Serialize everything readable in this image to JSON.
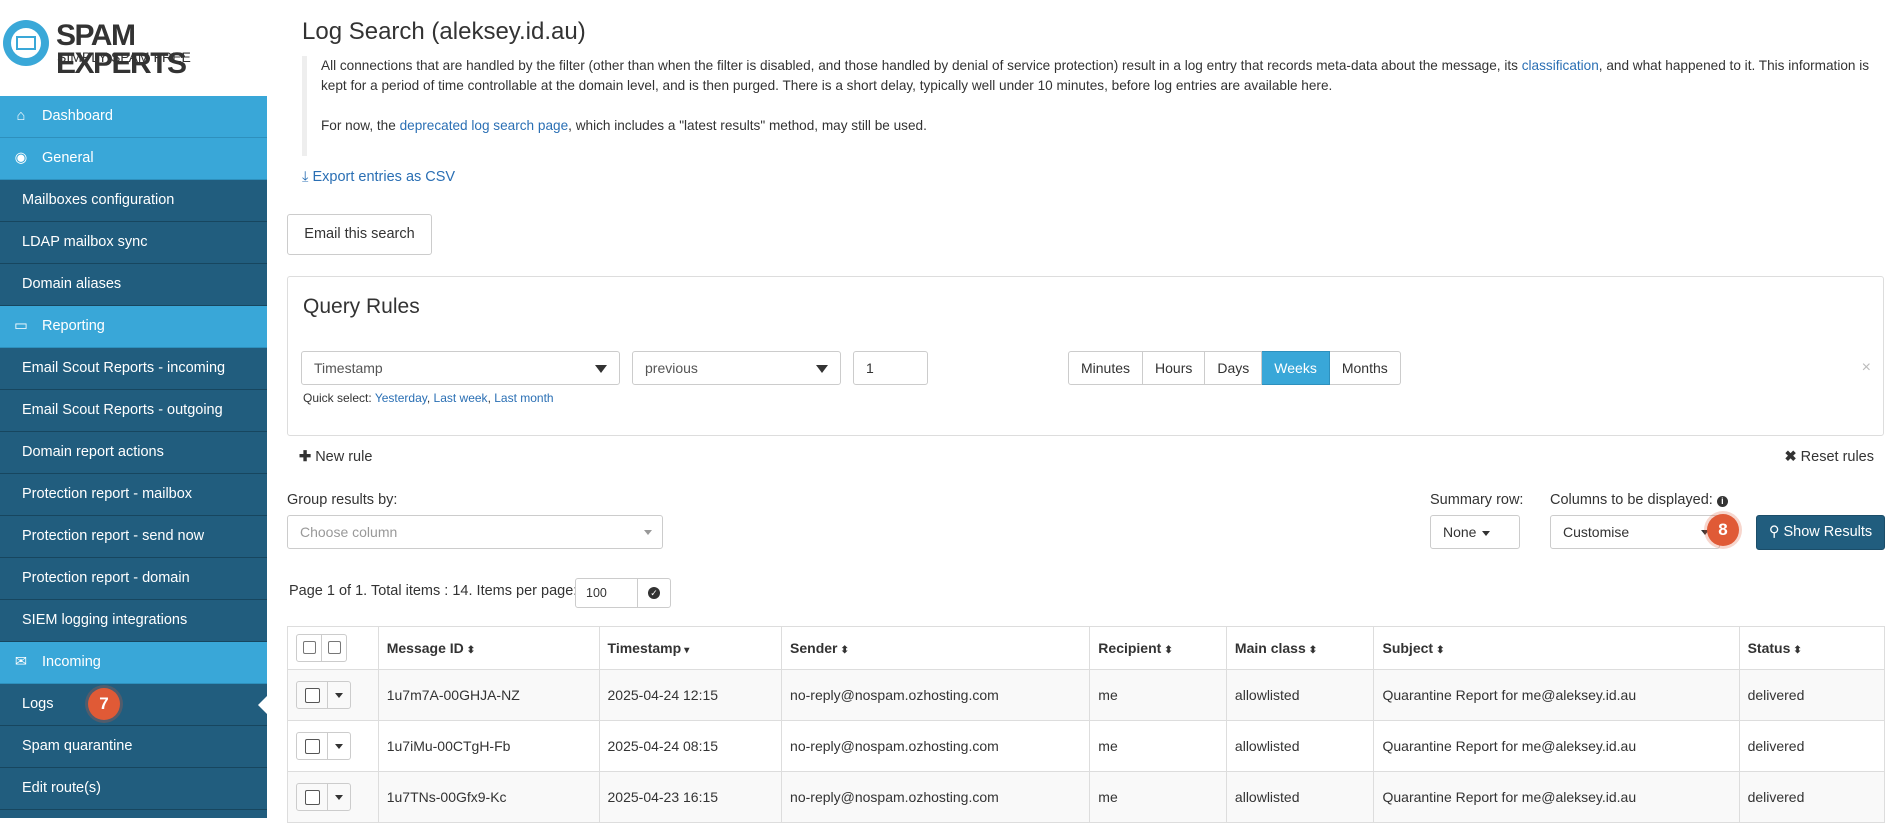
{
  "brand": {
    "name": "SPAM EXPERTS",
    "tagline": "SIMPLY SPAM FREE"
  },
  "sidebar": {
    "items": [
      {
        "type": "head",
        "label": "Dashboard",
        "icon": "home-icon",
        "glyph": "⌂"
      },
      {
        "type": "head",
        "label": "General",
        "icon": "globe-icon",
        "glyph": "◉"
      },
      {
        "type": "link",
        "label": "Mailboxes configuration"
      },
      {
        "type": "link",
        "label": "LDAP mailbox sync"
      },
      {
        "type": "link",
        "label": "Domain aliases"
      },
      {
        "type": "head",
        "label": "Reporting",
        "icon": "inbox-icon",
        "glyph": "▭"
      },
      {
        "type": "link",
        "label": "Email Scout Reports - incoming"
      },
      {
        "type": "link",
        "label": "Email Scout Reports - outgoing"
      },
      {
        "type": "link",
        "label": "Domain report actions"
      },
      {
        "type": "link",
        "label": "Protection report - mailbox"
      },
      {
        "type": "link",
        "label": "Protection report - send now"
      },
      {
        "type": "link",
        "label": "Protection report - domain"
      },
      {
        "type": "link",
        "label": "SIEM logging integrations"
      },
      {
        "type": "head",
        "label": "Incoming",
        "icon": "envelope-icon",
        "glyph": "✉"
      },
      {
        "type": "link",
        "label": "Logs",
        "active": true
      },
      {
        "type": "link",
        "label": "Spam quarantine"
      },
      {
        "type": "link",
        "label": "Edit route(s)"
      }
    ]
  },
  "badges": {
    "logs": "7",
    "show_results": "8"
  },
  "page": {
    "title": "Log Search (aleksey.id.au)",
    "intro1_a": "All connections that are handled by the filter (other than when the filter is disabled, and those handled by denial of service protection) result in a log entry that records meta-data about the message, its ",
    "intro1_link": "classification",
    "intro1_b": ", and what happened to it. This information is kept for a period of time controllable at the domain level, and is then purged. There is a short delay, typically well under 10 minutes, before log entries are available here.",
    "intro2_a": "For now, the ",
    "intro2_link": "deprecated log search page",
    "intro2_b": ", which includes a \"latest results\" method, may still be used.",
    "export_label": "Export entries as CSV",
    "email_search": "Email this search"
  },
  "query": {
    "title": "Query Rules",
    "field": "Timestamp",
    "operator": "previous",
    "amount": "1",
    "units": [
      "Minutes",
      "Hours",
      "Days",
      "Weeks",
      "Months"
    ],
    "unit_selected": "Weeks",
    "quick_label": "Quick select: ",
    "quick": [
      "Yesterday",
      "Last week",
      "Last month"
    ],
    "close": "×"
  },
  "controls": {
    "new_rule": "New rule",
    "reset_rules": "Reset rules",
    "group_label": "Group results by:",
    "group_placeholder": "Choose column",
    "summary_label": "Summary row:",
    "summary_value": "None",
    "columns_label": "Columns to be displayed:",
    "columns_value": "Customise",
    "show_results": "Show Results"
  },
  "pagination": {
    "text": "Page 1 of 1. Total items : 14. Items per page:",
    "per_page": "100"
  },
  "table": {
    "headers": [
      "Message ID",
      "Timestamp",
      "Sender",
      "Recipient",
      "Main class",
      "Subject",
      "Status"
    ],
    "rows": [
      [
        "1u7m7A-00GHJA-NZ",
        "2025-04-24 12:15",
        "no-reply@nospam.ozhosting.com",
        "me",
        "allowlisted",
        "Quarantine Report for me@aleksey.id.au",
        "delivered"
      ],
      [
        "1u7iMu-00CTgH-Fb",
        "2025-04-24 08:15",
        "no-reply@nospam.ozhosting.com",
        "me",
        "allowlisted",
        "Quarantine Report for me@aleksey.id.au",
        "delivered"
      ],
      [
        "1u7TNs-00Gfx9-Kc",
        "2025-04-23 16:15",
        "no-reply@nospam.ozhosting.com",
        "me",
        "allowlisted",
        "Quarantine Report for me@aleksey.id.au",
        "delivered"
      ]
    ]
  },
  "colors": {
    "sidebar": "#215d7e",
    "accent": "#39a7d8",
    "primary_button": "#215d7e",
    "badge": "#e05a36",
    "link": "#2a6fb4"
  }
}
